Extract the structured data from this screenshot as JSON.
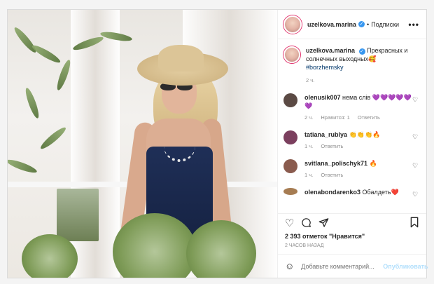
{
  "post": {
    "username": "uzelkova.marina",
    "follow_label": "Подписки",
    "more_label": "•••",
    "caption_text": "Прекрасных и солнечных выходных🥰",
    "hashtag": "#borzhemsky",
    "caption_time": "2 ч."
  },
  "comments": [
    {
      "user": "olenusik007",
      "text": "нема слів 💜💜💜💜💜💜",
      "time": "2 ч.",
      "likes": "Нравится: 1",
      "reply": "Ответить",
      "avatar_color": "#5b4a44"
    },
    {
      "user": "tatiana_rublya",
      "text": "👏👏👏🔥",
      "time": "1 ч.",
      "likes": "",
      "reply": "Ответить",
      "avatar_color": "#7b3f5e"
    },
    {
      "user": "svitlana_polischyk71",
      "text": "🔥",
      "time": "1 ч.",
      "likes": "",
      "reply": "Ответить",
      "avatar_color": "#8a5b4e"
    },
    {
      "user": "olenabondarenko3",
      "text": "Обалдеть❤️",
      "time": "",
      "likes": "",
      "reply": "",
      "avatar_color": "#a67c52"
    }
  ],
  "actions": {
    "like_icon": "heart-icon",
    "comment_icon": "comment-icon",
    "share_icon": "share-icon",
    "save_icon": "bookmark-icon"
  },
  "likes_text": "2 393 отметок \"Нравится\"",
  "time_ago": "2 ЧАСОВ НАЗАД",
  "comment_box": {
    "placeholder": "Добавьте комментарий...",
    "publish_label": "Опубликовать"
  },
  "colors": {
    "verified": "#3897f0",
    "hashtag": "#00376b",
    "publish": "#b2dffc"
  }
}
